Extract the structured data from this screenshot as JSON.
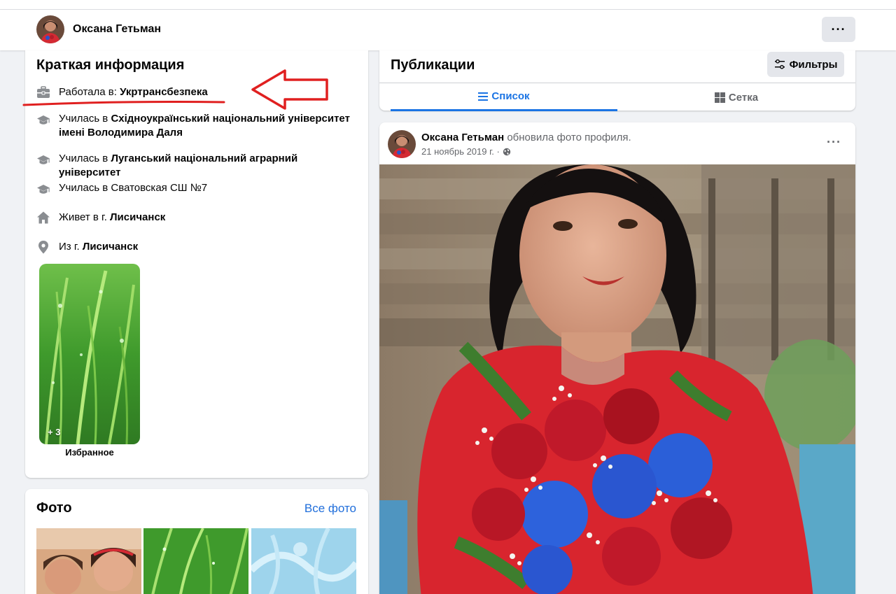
{
  "profile": {
    "name": "Оксана Гетьман",
    "more_label": "···"
  },
  "intro": {
    "title": "Краткая информация",
    "items": [
      {
        "prefix": "Работала в: ",
        "bold": "Укртрансбезпека",
        "icon": "briefcase-icon"
      },
      {
        "prefix": "Училась в ",
        "bold": "Східноукраїнський національний університет імені Володимира Даля",
        "icon": "graduation-cap-icon"
      },
      {
        "prefix": "Училась в ",
        "bold": "Луганський національний аграрний університет",
        "icon": "graduation-cap-icon"
      },
      {
        "prefix": "Училась в Сватовская СШ №7",
        "bold": "",
        "icon": "graduation-cap-icon"
      },
      {
        "prefix": "Живет в г. ",
        "bold": "Лисичанск",
        "icon": "home-icon"
      },
      {
        "prefix": "Из г. ",
        "bold": "Лисичанск",
        "icon": "location-pin-icon"
      }
    ],
    "highlight": {
      "count": "+ 3",
      "label": "Избранное"
    }
  },
  "photos": {
    "title": "Фото",
    "see_all": "Все фото"
  },
  "posts": {
    "title": "Публикации",
    "filter_label": "Фильтры",
    "tabs": [
      {
        "label": "Список",
        "active": true,
        "icon": "list-icon"
      },
      {
        "label": "Сетка",
        "active": false,
        "icon": "grid-icon"
      }
    ]
  },
  "post": {
    "author": "Оксана Гетьман",
    "action": " обновила фото профиля.",
    "date": "21 ноябрь 2019 г. · ",
    "privacy_icon": "globe-icon",
    "more_label": "···"
  },
  "colors": {
    "accent": "#1b74e4",
    "link": "#216fdb",
    "annotation_red": "#e02020",
    "secondary_text": "#65676b"
  }
}
